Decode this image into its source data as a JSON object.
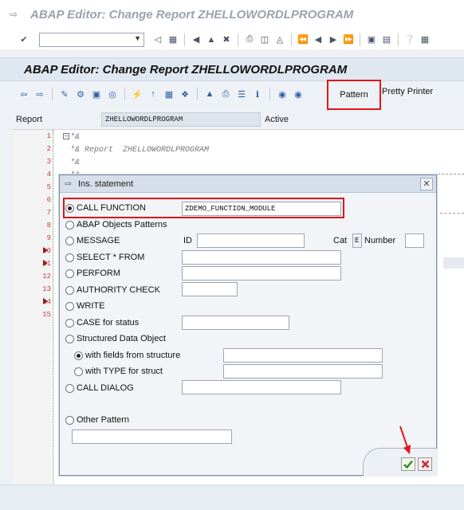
{
  "window": {
    "title": "ABAP Editor: Change Report ZHELLOWORDLPROGRAM"
  },
  "system_toolbar": {
    "command_field": ""
  },
  "app_header": {
    "title": "ABAP Editor: Change Report ZHELLOWORDLPROGRAM"
  },
  "app_toolbar": {
    "pattern_label": "Pattern",
    "pretty_printer_label": "Pretty Printer"
  },
  "report": {
    "label": "Report",
    "name": "ZHELLOWORDLPROGRAM",
    "status": "Active"
  },
  "editor": {
    "line_numbers": [
      "1",
      "2",
      "3",
      "4",
      "5",
      "6",
      "7",
      "8",
      "9",
      "10",
      "11",
      "12",
      "13",
      "14",
      "15"
    ],
    "code_lines": [
      "*&",
      "*& Report  ZHELLOWORDLPROGRAM",
      "*&",
      "*&"
    ]
  },
  "dialog": {
    "title": "Ins. statement",
    "options": {
      "call_function": "CALL FUNCTION",
      "call_function_value": "ZDEMO_FUNCTION_MODULE",
      "abap_objects": "ABAP Objects Patterns",
      "message": "MESSAGE",
      "message_id_label": "ID",
      "message_id_value": "",
      "message_cat_label": "Cat",
      "message_cat_value": "E",
      "message_number_label": "Number",
      "message_number_value": "",
      "select": "SELECT * FROM",
      "perform": "PERFORM",
      "authority": "AUTHORITY CHECK",
      "write": "WRITE",
      "case": "CASE for status",
      "structured": "Structured Data Object",
      "with_fields": "with fields from structure",
      "with_type": "with TYPE for struct",
      "call_dialog": "CALL DIALOG",
      "other": "Other Pattern"
    },
    "selected": "call_function"
  },
  "colors": {
    "highlight": "#e0161d",
    "ok": "#2e8b2e",
    "cancel": "#c62828"
  }
}
